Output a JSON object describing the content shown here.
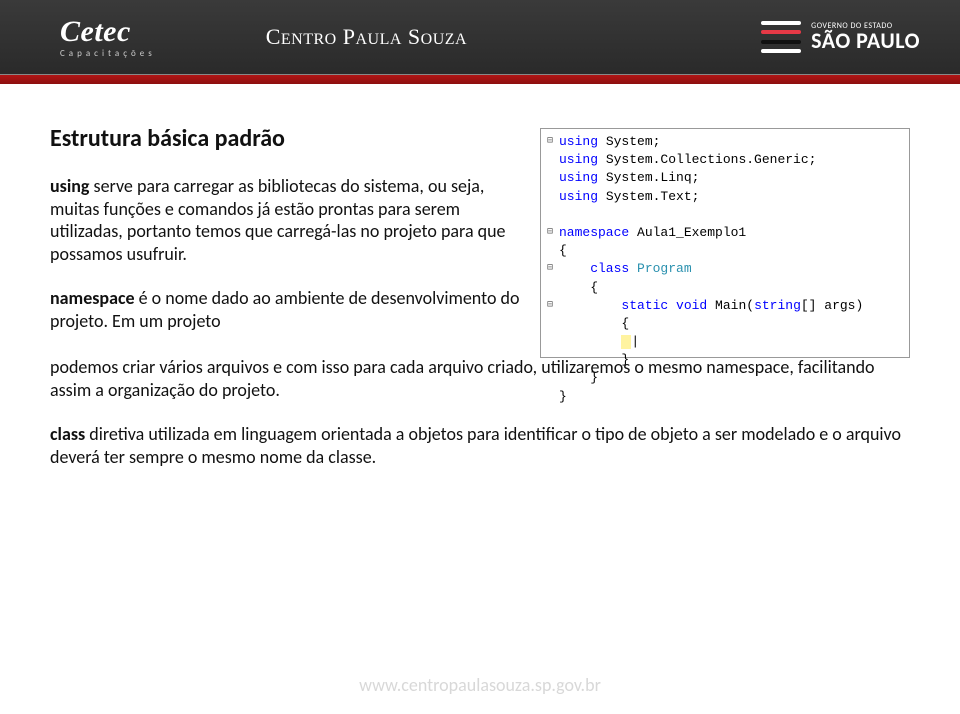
{
  "header": {
    "cetec": "Cetec",
    "cetec_sub": "Capacitações",
    "cps_prefix_c": "C",
    "cps_prefix_rest": "ENTRO",
    "cps_mid_p": " P",
    "cps_mid_rest": "AULA",
    "cps_end_s": " S",
    "cps_end_rest": "OUZA",
    "sp_gov": "GOVERNO DO ESTADO",
    "sp_main": "SÃO PAULO"
  },
  "title": "Estrutura básica padrão",
  "p1_b": "using",
  "p1_rest": " serve para carregar as bibliotecas do sistema, ou seja, muitas funções e comandos já estão prontas para serem utilizadas, portanto temos que carregá-las no projeto para que possamos usufruir.",
  "p2_b": "namespace",
  "p2_rest": " é o nome dado ao ambiente de desenvolvimento do projeto. Em um projeto",
  "p2_cont": "podemos criar vários arquivos e com isso para cada arquivo criado, utilizaremos o mesmo namespace, facilitando assim a organização do projeto.",
  "p3_b": "class",
  "p3_rest": " diretiva utilizada em linguagem orientada a objetos para identificar o tipo de objeto a ser modelado e o arquivo deverá ter sempre o mesmo nome da classe.",
  "code": {
    "l1a": "using",
    "l1b": " System;",
    "l2a": "using",
    "l2b": " System.Collections.Generic;",
    "l3a": "using",
    "l3b": " System.Linq;",
    "l4a": "using",
    "l4b": " System.Text;",
    "l6a": "namespace",
    "l6b": " Aula1_Exemplo1",
    "l7": "{",
    "l8a": "    class",
    "l8b": " ",
    "l8c": "Program",
    "l9": "    {",
    "l10a": "        static",
    "l10b": " ",
    "l10c": "void",
    "l10d": " Main(",
    "l10e": "string",
    "l10f": "[] args)",
    "l11": "        {",
    "l13": "        }",
    "l14": "    }",
    "l15": "}"
  },
  "footer": "www.centropaulasouza.sp.gov.br"
}
